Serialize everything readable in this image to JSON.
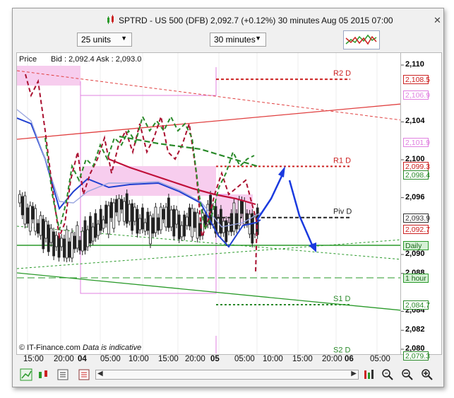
{
  "window": {
    "title": "SPTRD - US 500 (DFB)   2,092.7 (+0.12%)   30 minutes  Aug 05 2015 07:00",
    "close_glyph": "✕"
  },
  "controls": {
    "units": "25 units",
    "timeframe": "30 minutes"
  },
  "chart_header": {
    "price_label": "Price",
    "bid_ask": "Bid : 2,092.4  Ask : 2,093.0"
  },
  "footer": {
    "credit": "© IT-Finance.com",
    "note": "Data is indicative"
  },
  "levels": {
    "r2": "R2 D",
    "r1": "R1 D",
    "piv": "Piv D",
    "s1": "S1 D",
    "s2": "S2 D"
  },
  "y_axis": {
    "ticks": [
      "2,110",
      "2,104",
      "2,100",
      "2,096",
      "2,090",
      "2,088",
      "2,084",
      "2,082",
      "2,080"
    ],
    "tick_values": [
      2110,
      2104,
      2100,
      2096,
      2090,
      2088,
      2084,
      2082,
      2080
    ],
    "boxes": [
      {
        "text": "2,108.5",
        "color": "#cc2222",
        "value": 2108.5
      },
      {
        "text": "2,106.9",
        "color": "#e080e0",
        "value": 2106.9
      },
      {
        "text": "2,101.9",
        "color": "#e080e0",
        "value": 2101.9
      },
      {
        "text": "2,099.3",
        "color": "#cc2222",
        "value": 2099.3
      },
      {
        "text": "2,098.4",
        "color": "#2a8a2a",
        "value": 2098.4
      },
      {
        "text": "2,093.9",
        "color": "#333333",
        "value": 2093.9
      },
      {
        "text": "2,092.7",
        "color": "#cc2222",
        "value": 2092.7
      },
      {
        "text": "2,084.7",
        "color": "#2a8a2a",
        "value": 2084.7
      },
      {
        "text": "2,079.3",
        "color": "#2a8a2a",
        "value": 2079.3
      }
    ],
    "daily_label": "Daily",
    "hour_label": "1 hour"
  },
  "x_axis": {
    "labels": [
      "15:00",
      "20:00",
      "04",
      "05:00",
      "10:00",
      "15:00",
      "20:00",
      "05",
      "05:00",
      "10:00",
      "15:00",
      "20:00",
      "06",
      "05:00"
    ]
  },
  "toolbar": {
    "scroll_left": "◀",
    "scroll_right": "▶"
  },
  "colors": {
    "up_trend": "#cc2222",
    "support": "#2a9a2a",
    "projection": "#1a3adf",
    "ma_blue": "#2040d0",
    "ma_red": "#c0103a"
  }
}
